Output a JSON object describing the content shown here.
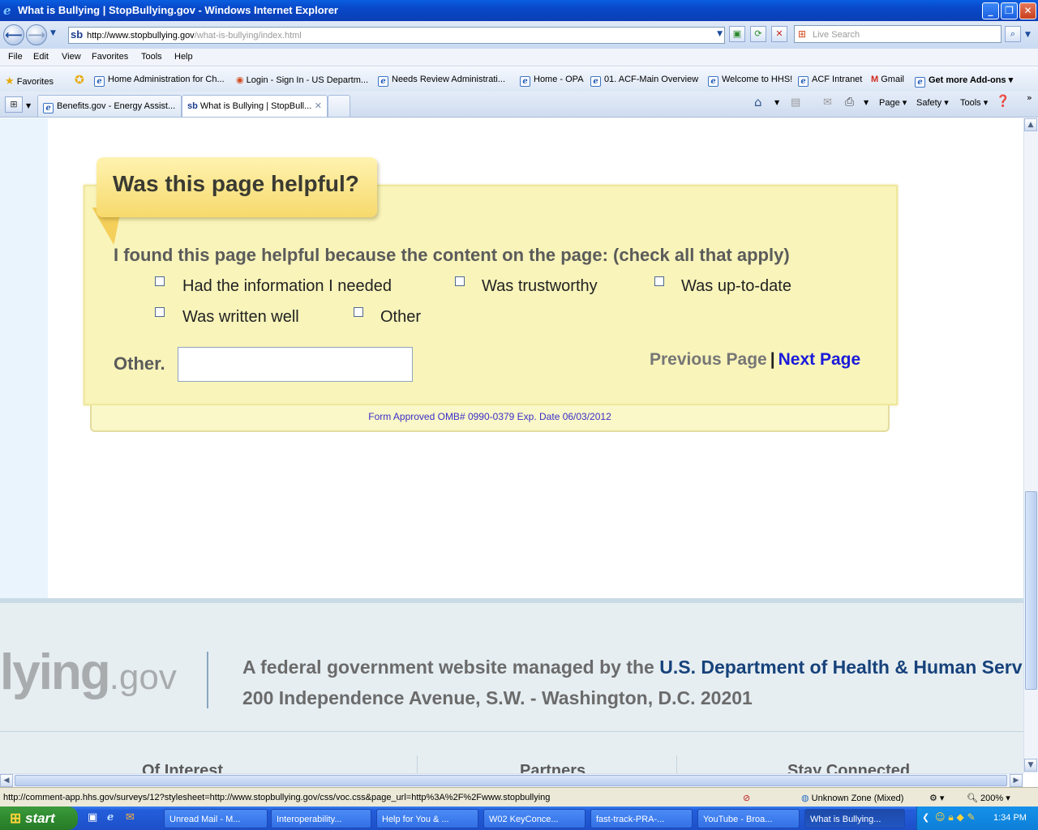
{
  "window": {
    "title": "What is Bullying | StopBullying.gov - Windows Internet Explorer"
  },
  "address_bar": {
    "url_host": "http://www.stopbullying.gov",
    "url_path": "/what-is-bullying/index.html",
    "search_placeholder": "Live Search"
  },
  "menu": {
    "items": [
      "File",
      "Edit",
      "View",
      "Favorites",
      "Tools",
      "Help"
    ]
  },
  "favorites_bar": {
    "label": "Favorites",
    "items": [
      "Home Administration for Ch...",
      "Login - Sign In - US Departm...",
      "Needs Review Administrati...",
      "Home - OPA",
      "01. ACF-Main Overview",
      "Welcome to HHS!",
      "ACF Intranet",
      "Gmail",
      "Get more Add-ons"
    ]
  },
  "tabs": [
    {
      "label": "Benefits.gov - Energy Assist...",
      "active": false
    },
    {
      "label": "What is Bullying | StopBull...",
      "active": true
    }
  ],
  "command_bar": {
    "page": "Page",
    "safety": "Safety",
    "tools": "Tools"
  },
  "feedback": {
    "heading": "Was this page helpful?",
    "question": "I found this page helpful because the content on the page: (check all that apply)",
    "options": [
      {
        "label": "Had the information I needed",
        "checked": false
      },
      {
        "label": "Was trustworthy",
        "checked": false
      },
      {
        "label": "Was up-to-date",
        "checked": false
      },
      {
        "label": "Was written well",
        "checked": false
      },
      {
        "label": "Other",
        "checked": false
      }
    ],
    "other_label": "Other.",
    "other_value": "",
    "previous_page": "Previous Page",
    "separator": "|",
    "next_page": "Next Page",
    "omb_notice": "Form Approved OMB# 0990-0379 Exp. Date 06/03/2012"
  },
  "footer": {
    "logo_text": "lying",
    "logo_suffix": ".gov",
    "managed_prefix": "A federal government website managed by the ",
    "department": "U.S. Department of Health & Human Services",
    "address": "200 Independence Avenue, S.W. - Washington, D.C. 20201",
    "columns": [
      "Of Interest",
      "Partners",
      "Stay Connected"
    ]
  },
  "status_bar": {
    "link_url": "http://comment-app.hhs.gov/surveys/12?stylesheet=http://www.stopbullying.gov/css/voc.css&page_url=http%3A%2F%2Fwww.stopbullying",
    "zone": "Unknown Zone (Mixed)",
    "zoom": "200%"
  },
  "taskbar": {
    "start": "start",
    "tasks": [
      {
        "label": "Unread Mail - M...",
        "active": false
      },
      {
        "label": "Interoperability...",
        "active": false
      },
      {
        "label": "Help for You & ...",
        "active": false
      },
      {
        "label": "W02 KeyConce...",
        "active": false
      },
      {
        "label": "fast-track-PRA-...",
        "active": false
      },
      {
        "label": "YouTube - Broa...",
        "active": false
      },
      {
        "label": "What is Bullying...",
        "active": true
      }
    ],
    "clock": "1:34 PM"
  },
  "colors": {
    "titlebar": "#0a5ee0",
    "card_background": "#f8f4ba",
    "next_link": "#1a1adb",
    "department_link": "#17427b",
    "start_button": "#3c9a3c"
  }
}
